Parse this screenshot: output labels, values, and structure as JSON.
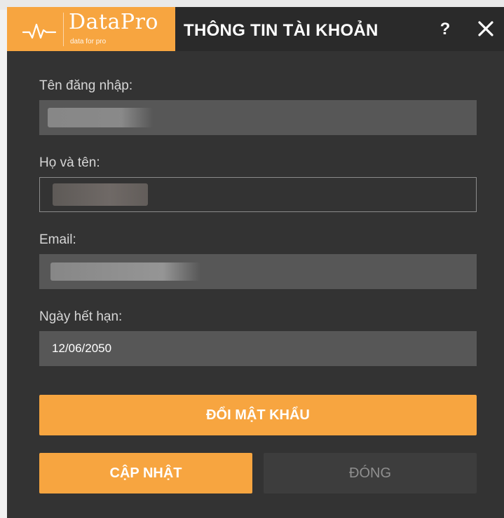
{
  "header": {
    "logo": {
      "name": "DataPro",
      "tagline": "data for pro"
    },
    "title": "THÔNG TIN TÀI KHOẢN",
    "help_label": "?"
  },
  "form": {
    "username": {
      "label": "Tên đăng nhập:",
      "value": ""
    },
    "fullname": {
      "label": "Họ và tên:",
      "value": ""
    },
    "email": {
      "label": "Email:",
      "value": ""
    },
    "expiry": {
      "label": "Ngày hết hạn:",
      "value": "12/06/2050"
    }
  },
  "buttons": {
    "change_password": "ĐỔI MẬT KHẨU",
    "update": "CẬP NHẬT",
    "close": "ĐÓNG"
  },
  "colors": {
    "accent": "#f7a540",
    "dialog_bg": "#333333",
    "titlebar_bg": "#2a2a2a",
    "field_bg": "#575757"
  },
  "icons": [
    "pulse-logo-icon",
    "help-icon",
    "close-icon"
  ]
}
